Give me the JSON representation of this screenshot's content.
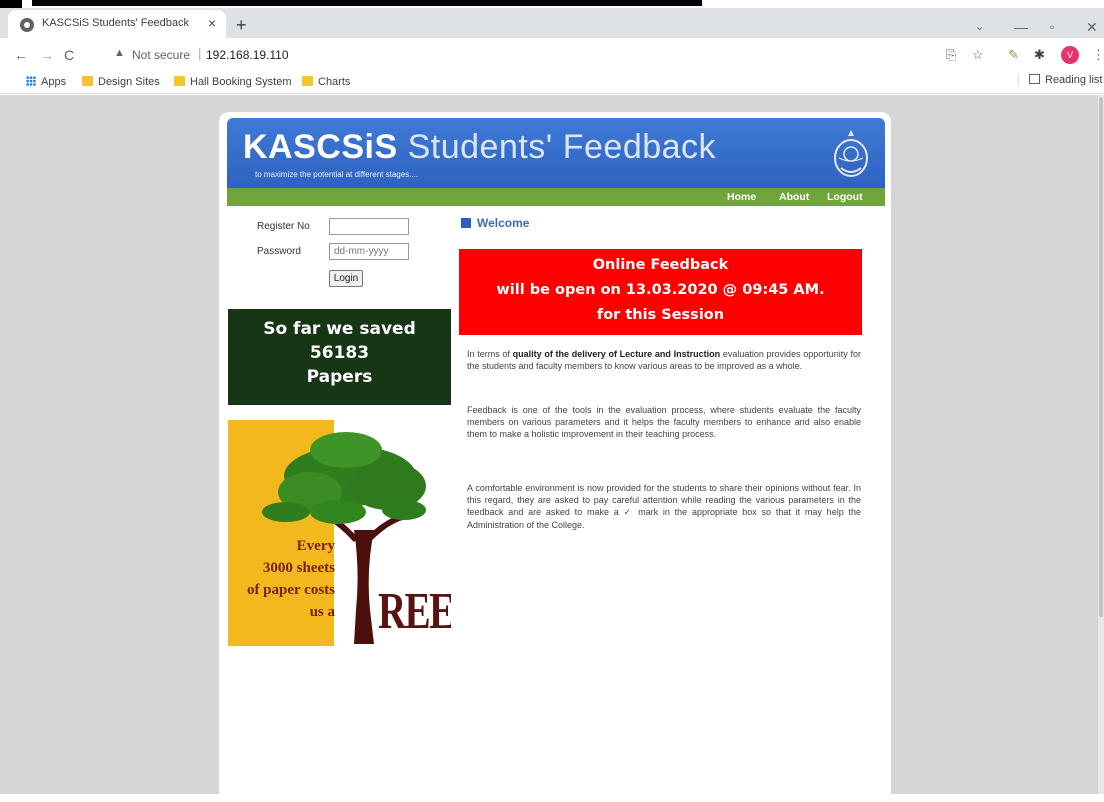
{
  "browser": {
    "tab_title": "KASCSiS Students' Feedback",
    "tab_close": "×",
    "new_tab": "+",
    "not_secure": "Not secure",
    "url": "192.168.19.110",
    "bookmarks": [
      "Apps",
      "Design Sites",
      "Hall Booking System",
      "Charts"
    ],
    "reading_list": "Reading list",
    "profile_initial": "V"
  },
  "site": {
    "title_part1": "KASCSiS",
    "title_part2": "Students' Feedback",
    "tagline": "to maximize the potential at different stages....",
    "nav": [
      "Home",
      "About",
      "Logout"
    ]
  },
  "login": {
    "register_label": "Register No",
    "password_label": "Password",
    "register_value": "",
    "password_placeholder": "dd-mm-yyyy",
    "login_button": "Login"
  },
  "saved": {
    "line1": "So far we saved",
    "count": "56183",
    "line3": "Papers"
  },
  "tree_banner": {
    "line1": "Every",
    "line2": "3000 sheets",
    "line3": "of paper costs",
    "line4": "us a",
    "big_word": "REE"
  },
  "main": {
    "welcome": "Welcome",
    "notice_line1": "Online Feedback",
    "notice_line2": "will be open on 13.03.2020 @ 09:45 AM.",
    "notice_line3": "for this Session",
    "p1_a": "In terms of ",
    "p1_b": "quality of the delivery of Lecture and Instruction",
    "p1_c": " evaluation provides opportunity for the students and faculty members to know various areas to be improved as a whole.",
    "p2": "Feedback is one of the tools in the evaluation process, where students evaluate the faculty members on various parameters and it helps the faculty members to enhance and also enable them to make a holistic improvement in their teaching process.",
    "p3": "A comfortable environment is now provided for the students to share their opinions without fear. In this regard, they are asked to pay careful attention while reading the various parameters in the feedback and are asked to make a ✓ mark in the appropriate box so that it may help the Administration of the College."
  },
  "colors": {
    "header_blue": "#2e62c2",
    "nav_green": "#6fa53a",
    "saved_green": "#163616",
    "notice_red": "#ff0000",
    "tree_yellow": "#f3b81e"
  }
}
